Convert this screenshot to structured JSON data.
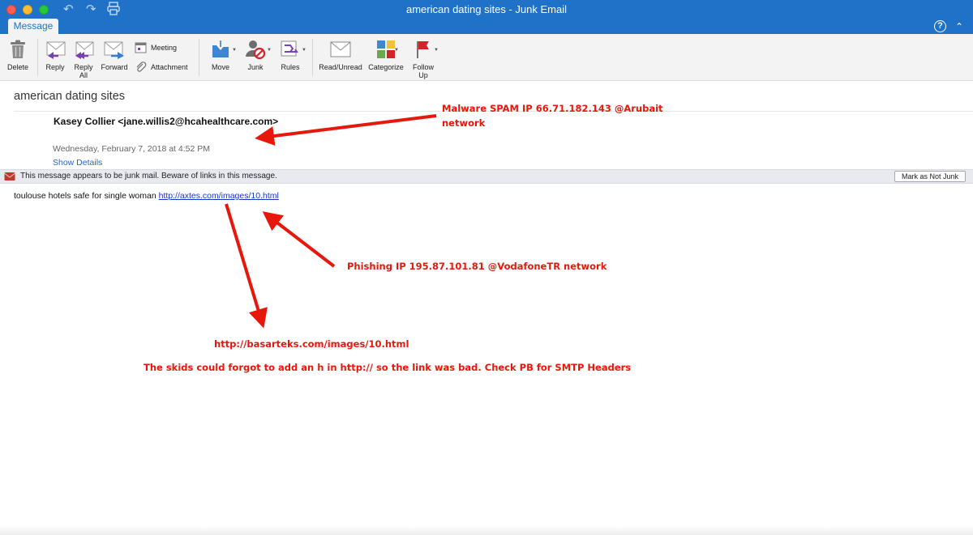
{
  "window": {
    "title": "american dating sites - Junk Email"
  },
  "ribbon": {
    "active_tab": "Message",
    "buttons": {
      "delete": "Delete",
      "reply": "Reply",
      "reply_all": "Reply\nAll",
      "forward": "Forward",
      "meeting": "Meeting",
      "attachment": "Attachment",
      "move": "Move",
      "junk": "Junk",
      "rules": "Rules",
      "read_unread": "Read/Unread",
      "categorize": "Categorize",
      "follow_up": "Follow\nUp"
    }
  },
  "message": {
    "subject": "american dating sites",
    "sender": "Kasey Collier <jane.willis2@hcahealthcare.com>",
    "datetime": "Wednesday, February 7, 2018 at 4:52 PM",
    "show_details": "Show Details",
    "junk_warning": "This message appears to be junk mail. Beware of links in this message.",
    "not_junk_button": "Mark as Not Junk",
    "body_text": "toulouse hotels safe for single woman ",
    "body_link": "http://axtes.com/images/10.html"
  },
  "annotations": {
    "malware": "Malware SPAM IP 66.71.182.143 @Arubait network",
    "phishing": "Phishing IP 195.87.101.81 @VodafoneTR network",
    "real_url": "http://basarteks.com/images/10.html",
    "note": "The skids could forgot to add an h in http:// so the link was bad. Check PB for SMTP Headers"
  },
  "colors": {
    "titlebar": "#1f72c7",
    "annotation": "#e8170c",
    "link": "#1a33c9"
  }
}
